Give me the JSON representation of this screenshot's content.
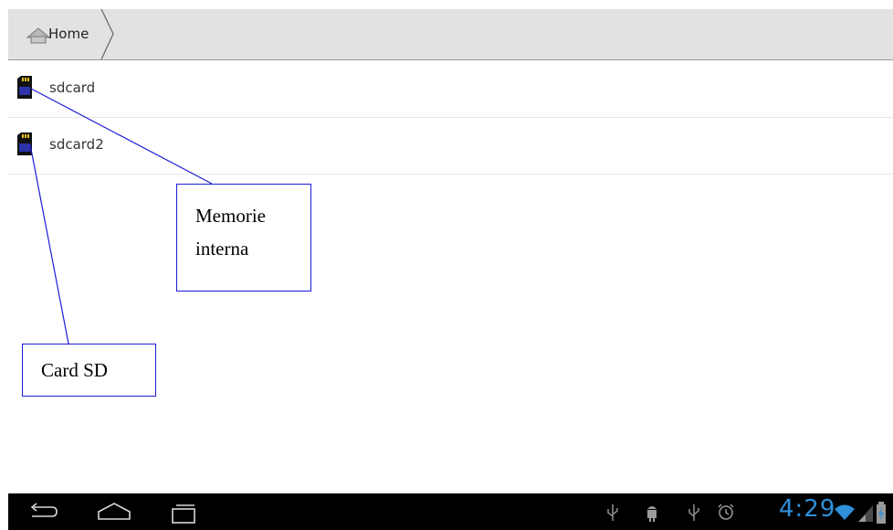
{
  "breadcrumb": {
    "home_label": "Home"
  },
  "storage_list": {
    "items": [
      {
        "label": "sdcard"
      },
      {
        "label": "sdcard2"
      }
    ]
  },
  "annotations": {
    "internal_memory": "Memorie\ninterna",
    "internal_memory_line1": "Memorie",
    "internal_memory_line2": "interna",
    "sd_card": "Card SD"
  },
  "status_bar": {
    "time": "4:29"
  },
  "colors": {
    "accent_clock": "#2f8fd8",
    "annotation_border": "#1c1cd6",
    "breadcrumb_bg": "#e2e2e2",
    "navbar_bg": "#000000"
  },
  "icons": {
    "home": "home-icon",
    "sd_card": "sd-card-icon",
    "back": "back-icon",
    "home_nav": "home-nav-icon",
    "recents": "recent-apps-icon",
    "usb": "usb-icon",
    "android_debug": "android-debug-icon",
    "alarm": "alarm-icon",
    "wifi": "wifi-icon",
    "signal": "signal-icon",
    "battery": "battery-icon"
  }
}
